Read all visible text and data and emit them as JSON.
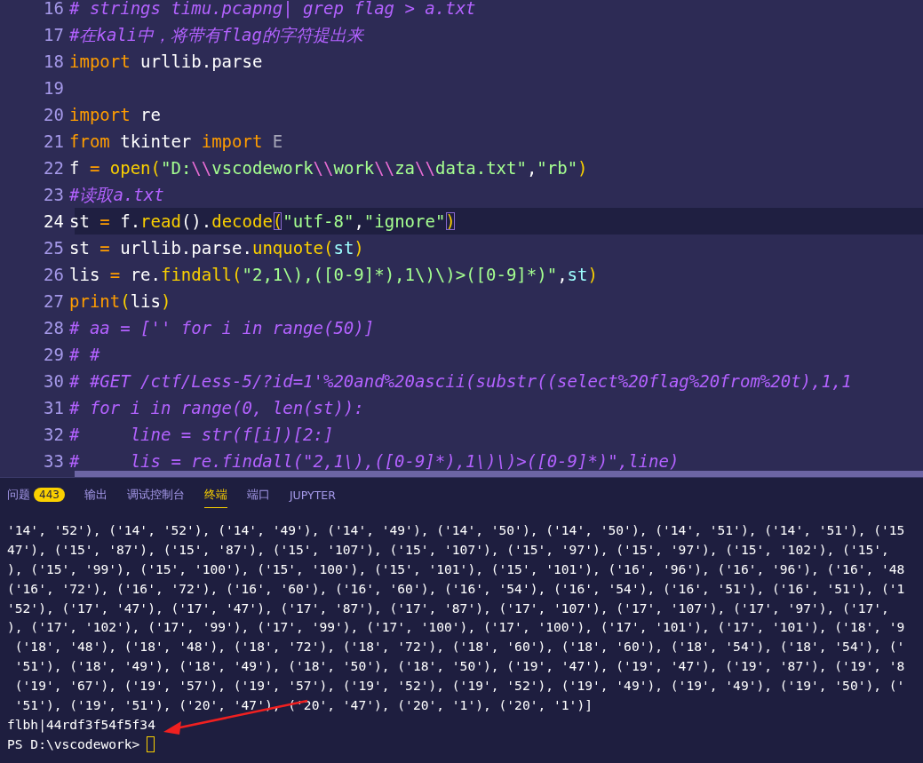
{
  "editor": {
    "lines": [
      {
        "number": "16",
        "current": false,
        "tokens": [
          {
            "kind": "comment",
            "text": "# strings timu.pcapng| grep flag > a.txt"
          }
        ]
      },
      {
        "number": "17",
        "current": false,
        "tokens": [
          {
            "kind": "comment",
            "text": "#在kali中，将带有flag的字符提出来"
          }
        ]
      },
      {
        "number": "18",
        "current": false,
        "tokens": [
          {
            "kind": "keyword",
            "text": "import"
          },
          {
            "kind": "plain",
            "text": " urllib.parse"
          }
        ]
      },
      {
        "number": "19",
        "current": false
      },
      {
        "number": "20",
        "current": false,
        "tokens": [
          {
            "kind": "keyword",
            "text": "import"
          },
          {
            "kind": "plain",
            "text": " re"
          }
        ]
      },
      {
        "number": "21",
        "current": false,
        "tokens": [
          {
            "kind": "keyword",
            "text": "from"
          },
          {
            "kind": "plain",
            "text": " tkinter "
          },
          {
            "kind": "keyword",
            "text": "import"
          },
          {
            "kind": "unused",
            "text": " E"
          }
        ]
      },
      {
        "number": "22",
        "current": false,
        "tokens": [
          {
            "kind": "plain",
            "text": "f "
          },
          {
            "kind": "operator",
            "text": "="
          },
          {
            "kind": "function",
            "text": " open"
          },
          {
            "kind": "paren",
            "text": "("
          },
          {
            "kind": "string",
            "text": "\"D:"
          },
          {
            "kind": "escape",
            "text": "\\\\"
          },
          {
            "kind": "string",
            "text": "vscodework"
          },
          {
            "kind": "escape",
            "text": "\\\\"
          },
          {
            "kind": "string",
            "text": "work"
          },
          {
            "kind": "escape",
            "text": "\\\\"
          },
          {
            "kind": "string",
            "text": "za"
          },
          {
            "kind": "escape",
            "text": "\\\\"
          },
          {
            "kind": "string",
            "text": "data.txt\""
          },
          {
            "kind": "plain",
            "text": ","
          },
          {
            "kind": "string",
            "text": "\"rb\""
          },
          {
            "kind": "paren",
            "text": ")"
          }
        ]
      },
      {
        "number": "23",
        "current": false,
        "tokens": [
          {
            "kind": "comment",
            "text": "#读取a.txt"
          }
        ]
      },
      {
        "number": "24",
        "current": true,
        "tokens": [
          {
            "kind": "plain",
            "text": "st "
          },
          {
            "kind": "operator",
            "text": "="
          },
          {
            "kind": "plain",
            "text": " f."
          },
          {
            "kind": "function",
            "text": "read"
          },
          {
            "kind": "plain",
            "text": "()."
          },
          {
            "kind": "function",
            "text": "decode"
          },
          {
            "kind": "paren_match",
            "text": "("
          },
          {
            "kind": "string",
            "text": "\"utf-8\""
          },
          {
            "kind": "plain",
            "text": ","
          },
          {
            "kind": "string",
            "text": "\"ignore\""
          },
          {
            "kind": "paren_match",
            "text": ")"
          }
        ]
      },
      {
        "number": "25",
        "current": false,
        "tokens": [
          {
            "kind": "plain",
            "text": "st "
          },
          {
            "kind": "operator",
            "text": "="
          },
          {
            "kind": "plain",
            "text": " urllib.parse."
          },
          {
            "kind": "function",
            "text": "unquote"
          },
          {
            "kind": "paren",
            "text": "("
          },
          {
            "kind": "variable",
            "text": "st"
          },
          {
            "kind": "paren",
            "text": ")"
          }
        ]
      },
      {
        "number": "26",
        "current": false,
        "tokens": [
          {
            "kind": "plain",
            "text": "lis "
          },
          {
            "kind": "operator",
            "text": "="
          },
          {
            "kind": "plain",
            "text": " re."
          },
          {
            "kind": "function",
            "text": "findall"
          },
          {
            "kind": "paren",
            "text": "("
          },
          {
            "kind": "string",
            "text": "\"2,1\\),([0-9]*),1\\)\\)>([0-9]*)\""
          },
          {
            "kind": "plain",
            "text": ","
          },
          {
            "kind": "variable",
            "text": "st"
          },
          {
            "kind": "paren",
            "text": ")"
          }
        ]
      },
      {
        "number": "27",
        "current": false,
        "tokens": [
          {
            "kind": "keyword",
            "text": "print"
          },
          {
            "kind": "paren",
            "text": "("
          },
          {
            "kind": "plain",
            "text": "lis"
          },
          {
            "kind": "paren",
            "text": ")"
          }
        ]
      },
      {
        "number": "28",
        "current": false,
        "tokens": [
          {
            "kind": "comment",
            "text": "# aa = ['' for i in range(50)]"
          }
        ]
      },
      {
        "number": "29",
        "current": false,
        "tokens": [
          {
            "kind": "comment",
            "text": "# #"
          }
        ]
      },
      {
        "number": "30",
        "current": false,
        "tokens": [
          {
            "kind": "comment",
            "text": "# #GET /ctf/Less-5/?id=1'%20and%20ascii(substr((select%20flag%20from%20t),1,1"
          }
        ]
      },
      {
        "number": "31",
        "current": false,
        "tokens": [
          {
            "kind": "comment",
            "text": "# for i in range(0, len(st)):"
          }
        ]
      },
      {
        "number": "32",
        "current": false,
        "tokens": [
          {
            "kind": "comment",
            "text": "#     line = str(f[i])[2:]"
          }
        ]
      },
      {
        "number": "33",
        "current": false,
        "tokens": [
          {
            "kind": "comment",
            "text": "#     lis = re.findall(\"2,1\\),([0-9]*),1\\)\\)>([0-9]*)\",line)"
          }
        ]
      }
    ]
  },
  "panel": {
    "tabs": [
      {
        "label": "问题",
        "badge": "443",
        "selected": false
      },
      {
        "label": "输出",
        "selected": false
      },
      {
        "label": "调试控制台",
        "selected": false
      },
      {
        "label": "终端",
        "selected": true
      },
      {
        "label": "端口",
        "selected": false
      },
      {
        "label": "JUPYTER",
        "selected": false
      }
    ],
    "terminal": {
      "lines": [
        "'14', '52'), ('14', '52'), ('14', '49'), ('14', '49'), ('14', '50'), ('14', '50'), ('14', '51'), ('14', '51'), ('15",
        "47'), ('15', '87'), ('15', '87'), ('15', '107'), ('15', '107'), ('15', '97'), ('15', '97'), ('15', '102'), ('15',",
        "), ('15', '99'), ('15', '100'), ('15', '100'), ('15', '101'), ('15', '101'), ('16', '96'), ('16', '96'), ('16', '48",
        "('16', '72'), ('16', '72'), ('16', '60'), ('16', '60'), ('16', '54'), ('16', '54'), ('16', '51'), ('16', '51'), ('1",
        "'52'), ('17', '47'), ('17', '47'), ('17', '87'), ('17', '87'), ('17', '107'), ('17', '107'), ('17', '97'), ('17',",
        "), ('17', '102'), ('17', '99'), ('17', '99'), ('17', '100'), ('17', '100'), ('17', '101'), ('17', '101'), ('18', '9",
        " ('18', '48'), ('18', '48'), ('18', '72'), ('18', '72'), ('18', '60'), ('18', '60'), ('18', '54'), ('18', '54'), ('",
        " '51'), ('18', '49'), ('18', '49'), ('18', '50'), ('18', '50'), ('19', '47'), ('19', '47'), ('19', '87'), ('19', '8",
        " ('19', '67'), ('19', '57'), ('19', '57'), ('19', '52'), ('19', '52'), ('19', '49'), ('19', '49'), ('19', '50'), ('",
        " '51'), ('19', '51'), ('20', '47'), ('20', '47'), ('20', '1'), ('20', '1')]",
        "flbh|44rdf3f54f5f34"
      ],
      "prompt": "PS D:\\vscodework>"
    }
  }
}
